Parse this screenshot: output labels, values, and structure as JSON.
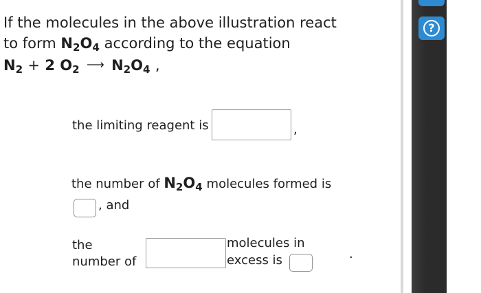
{
  "question": {
    "line1": "If the molecules in the above illustration react",
    "line2_prefix": "to form",
    "line2_suffix": "according to the equation",
    "product": {
      "base1": "N",
      "sub1": "2",
      "base2": "O",
      "sub2": "4"
    },
    "equation": {
      "reactant1": {
        "base": "N",
        "sub": "2"
      },
      "plus": "+",
      "coefficient": "2",
      "reactant2": {
        "base": "O",
        "sub": "2"
      },
      "arrow": "⟶",
      "product": {
        "base1": "N",
        "sub1": "2",
        "base2": "O",
        "sub2": "4"
      },
      "trailing": ","
    }
  },
  "answers": {
    "limiting_reagent_label": "the limiting reagent is",
    "limiting_reagent_value": "",
    "comma_after_limiting": ",",
    "molecules_formed_prefix": "the number of",
    "molecules_formed_suffix": "molecules formed is",
    "molecules_formed_value": "",
    "and_text": ", and",
    "excess_label_1": "the",
    "excess_label_2": "number of",
    "excess_reagent_value": "",
    "excess_middle_1": "molecules in",
    "excess_middle_2": "excess is",
    "excess_count_value": "",
    "period": "."
  },
  "sidebar": {
    "help_icon": "question-circle-icon",
    "help_glyph": "?",
    "accent_color": "#2f8bd1"
  }
}
